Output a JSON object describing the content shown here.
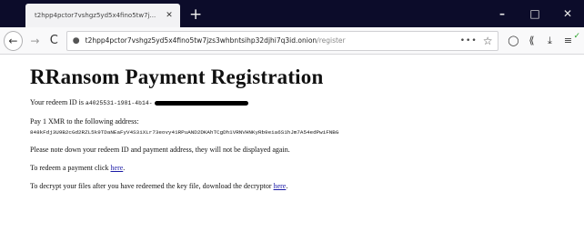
{
  "window": {
    "tab_title": "t2hpp4pctor7vshgz5yd5x4fino5tw7j...",
    "tab_close": "✕",
    "new_tab": "+",
    "minimize": "–",
    "maximize": "□",
    "close": "✕"
  },
  "nav": {
    "back": "←",
    "forward": "→",
    "reload": "C",
    "url_host": "t2hpp4pctor7vshgz5yd5x4fino5tw7jzs3whbntsihp32djhi7q3id.onion",
    "url_path": "/register",
    "page_actions": "•••",
    "bookmark": "☆",
    "toolbar_icons": [
      "◯",
      "⟪",
      "⤓",
      "≡"
    ],
    "badge": "✓"
  },
  "page": {
    "title": "RRansom Payment Registration",
    "redeem_prefix": "Your redeem ID is",
    "redeem_id": "a4025531-1981-4b14-",
    "pay_line": "Pay 1 XMR to the following address:",
    "address": "848kFdj3U9B2cGd2RZL5k9TDaNEaFyV4S3iXLr73eovy41RPuAND2DKAhTCgDh1VRNVHNKyRb9eia6S1hJm7A54edPwiFNBG",
    "note": "Please note down your redeem ID and payment address, they will not be displayed again.",
    "redeem_text": "To redeem a payment click",
    "redeem_link": "here",
    "redeem_end": ".",
    "decrypt_text": "To decrypt your files after you have redeemed the key file, download the decryptor",
    "decrypt_link": "here",
    "decrypt_end": "."
  }
}
